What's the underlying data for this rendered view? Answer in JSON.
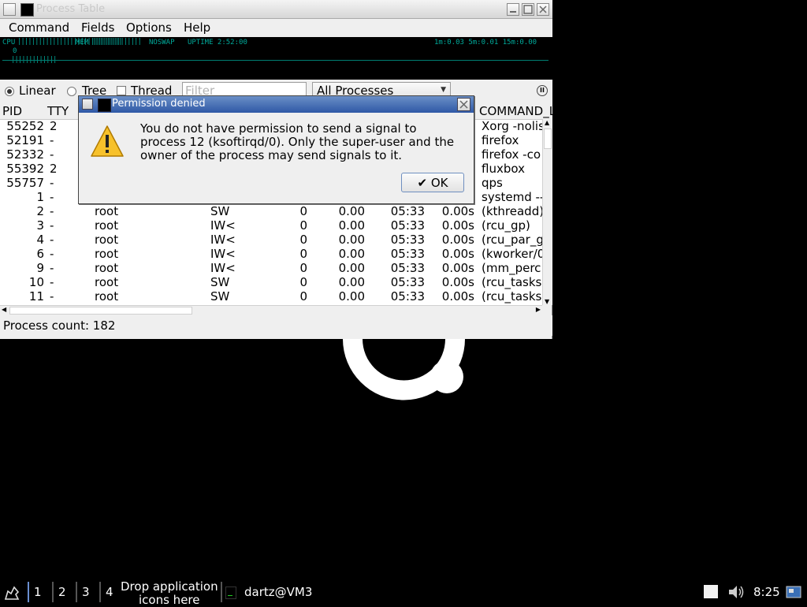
{
  "window": {
    "title": "Process Table"
  },
  "menu": [
    "Command",
    "Fields",
    "Options",
    "Help"
  ],
  "infobar": {
    "cpu_label": "CPU",
    "mem_label": "MEM",
    "swap_label": "NOSWAP",
    "uptime_label": "UPTIME 2:52:00",
    "load_label": "1m:0.03 5m:0.01 15m:0.00",
    "cpu_value": "0"
  },
  "toolbar": {
    "linear_label": "Linear",
    "tree_label": "Tree",
    "thread_label": "Thread",
    "filter_placeholder": "Filter",
    "process_select": "All Processes"
  },
  "table": {
    "headers": [
      "PID",
      "TTY",
      "COMMAND_L"
    ],
    "rows": [
      {
        "pid": "55252",
        "tty": "2",
        "user": "",
        "stat": "",
        "nice": "",
        "cpu": "",
        "start": "",
        "time": "",
        "cmd": "Xorg -nolis"
      },
      {
        "pid": "52191",
        "tty": "-",
        "user": "",
        "stat": "",
        "nice": "",
        "cpu": "",
        "start": "",
        "time": "",
        "cmd": "firefox"
      },
      {
        "pid": "52332",
        "tty": "-",
        "user": "",
        "stat": "",
        "nice": "",
        "cpu": "",
        "start": "",
        "time": "",
        "cmd": "firefox -co"
      },
      {
        "pid": "55392",
        "tty": "2",
        "user": "",
        "stat": "",
        "nice": "",
        "cpu": "",
        "start": "",
        "time": "",
        "cmd": "fluxbox"
      },
      {
        "pid": "55757",
        "tty": "-",
        "user": "",
        "stat": "",
        "nice": "",
        "cpu": "",
        "start": "",
        "time": "",
        "cmd": "qps"
      },
      {
        "pid": "1",
        "tty": "-",
        "user": "",
        "stat": "",
        "nice": "",
        "cpu": "",
        "start": "",
        "time": "",
        "cmd": "systemd --"
      },
      {
        "pid": "2",
        "tty": "-",
        "user": "root",
        "stat": "SW",
        "nice": "0",
        "cpu": "0.00",
        "start": "05:33",
        "time": "0.00s",
        "cmd": "(kthreadd)"
      },
      {
        "pid": "3",
        "tty": "-",
        "user": "root",
        "stat": "IW<",
        "nice": "0",
        "cpu": "0.00",
        "start": "05:33",
        "time": "0.00s",
        "cmd": "(rcu_gp)"
      },
      {
        "pid": "4",
        "tty": "-",
        "user": "root",
        "stat": "IW<",
        "nice": "0",
        "cpu": "0.00",
        "start": "05:33",
        "time": "0.00s",
        "cmd": "(rcu_par_g"
      },
      {
        "pid": "6",
        "tty": "-",
        "user": "root",
        "stat": "IW<",
        "nice": "0",
        "cpu": "0.00",
        "start": "05:33",
        "time": "0.00s",
        "cmd": "(kworker/0"
      },
      {
        "pid": "9",
        "tty": "-",
        "user": "root",
        "stat": "IW<",
        "nice": "0",
        "cpu": "0.00",
        "start": "05:33",
        "time": "0.00s",
        "cmd": "(mm_perc"
      },
      {
        "pid": "10",
        "tty": "-",
        "user": "root",
        "stat": "SW",
        "nice": "0",
        "cpu": "0.00",
        "start": "05:33",
        "time": "0.00s",
        "cmd": "(rcu_tasks"
      },
      {
        "pid": "11",
        "tty": "-",
        "user": "root",
        "stat": "SW",
        "nice": "0",
        "cpu": "0.00",
        "start": "05:33",
        "time": "0.00s",
        "cmd": "(rcu_tasks"
      }
    ]
  },
  "status": {
    "process_count": "Process count: 182"
  },
  "dialog": {
    "title": "Permission denied",
    "message": "You do not have permission to send a signal to process 12 (ksoftirqd/0). Only the super-user and the owner of the process may send signals to it.",
    "ok_label": "OK"
  },
  "taskbar": {
    "workspaces": [
      "1",
      "2",
      "3",
      "4"
    ],
    "drop_text_1": "Drop application",
    "drop_text_2": "icons here",
    "task_label": "dartz@VM3",
    "clock": "8:25"
  }
}
